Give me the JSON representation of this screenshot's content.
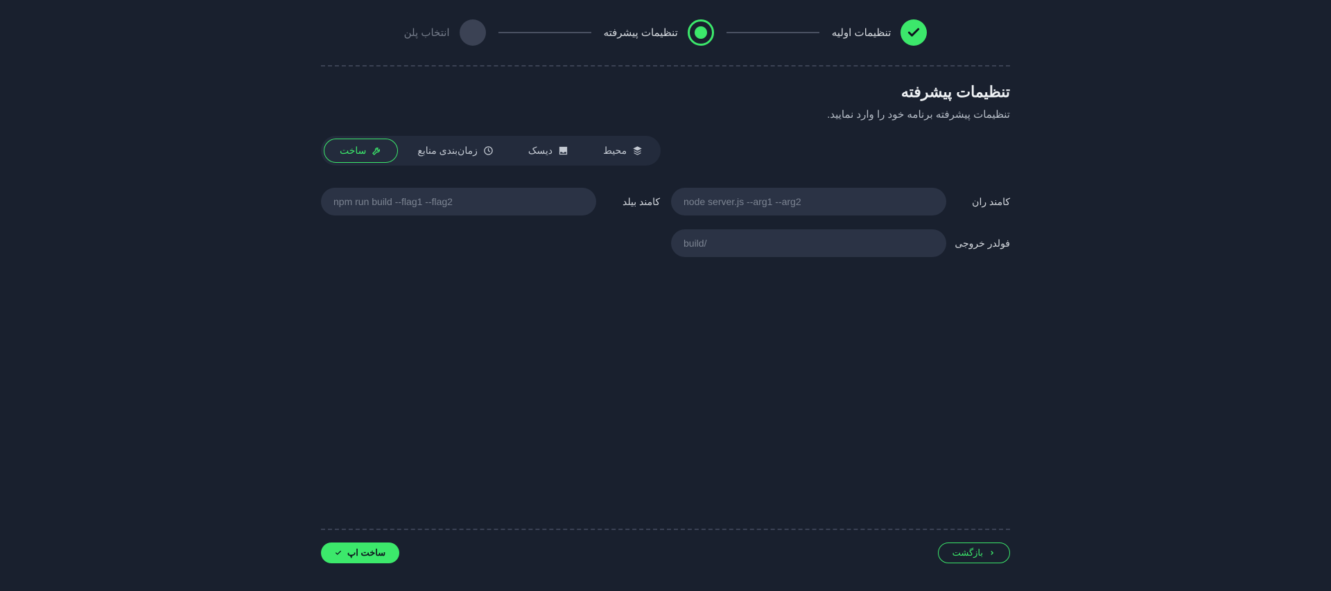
{
  "stepper": {
    "steps": [
      {
        "label": "تنظیمات اولیه",
        "state": "done"
      },
      {
        "label": "تنظیمات پیشرفته",
        "state": "active"
      },
      {
        "label": "انتخاب پلن",
        "state": "pending"
      }
    ]
  },
  "header": {
    "title": "تنظیمات پیشرفته",
    "subtitle": "تنظیمات پیشرفته برنامه خود را وارد نمایید."
  },
  "tabs": {
    "items": [
      {
        "label": "محیط",
        "icon": "stack"
      },
      {
        "label": "دیسک",
        "icon": "inbox"
      },
      {
        "label": "زمان‌بندی منابع",
        "icon": "clock"
      },
      {
        "label": "ساخت",
        "icon": "wrench",
        "active": true
      }
    ]
  },
  "form": {
    "run_cmd": {
      "label": "کامند ران",
      "placeholder": "node server.js --arg1 --arg2"
    },
    "build_cmd": {
      "label": "کامند بیلد",
      "placeholder": "npm run build --flag1 --flag2"
    },
    "out_dir": {
      "label": "فولدر خروجی",
      "placeholder": "build/"
    }
  },
  "footer": {
    "back": "بازگشت",
    "create": "ساخت اپ"
  }
}
